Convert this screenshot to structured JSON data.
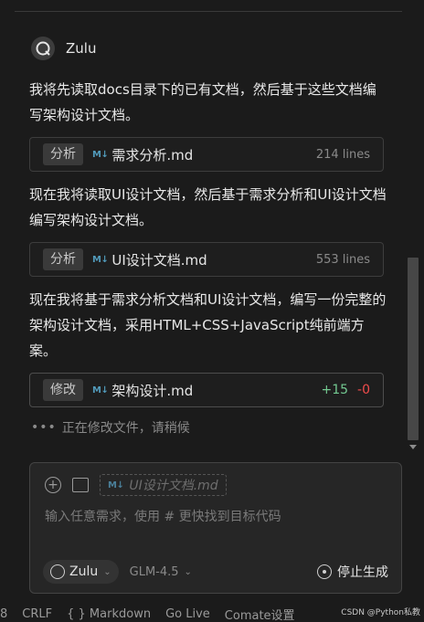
{
  "agent": {
    "name": "Zulu"
  },
  "messages": [
    {
      "text": "我将先读取docs目录下的已有文档，然后基于这些文档编写架构设计文档。"
    },
    {
      "text": "现在我将读取UI设计文档，然后基于需求分析和UI设计文档编写架构设计文档。"
    },
    {
      "text": "现在我将基于需求分析文档和UI设计文档，编写一份完整的架构设计文档，采用HTML+CSS+JavaScript纯前端方案。"
    }
  ],
  "file_cards": [
    {
      "tag": "分析",
      "icon": "markdown-icon",
      "icon_text": "M↓",
      "name": "需求分析.md",
      "meta": "214 lines"
    },
    {
      "tag": "分析",
      "icon": "markdown-icon",
      "icon_text": "M↓",
      "name": "UI设计文档.md",
      "meta": "553 lines"
    },
    {
      "tag": "修改",
      "icon": "markdown-icon",
      "icon_text": "M↓",
      "name": "架构设计.md",
      "added": "+15",
      "removed": "-0"
    }
  ],
  "status": {
    "dots": "•••",
    "text": "正在修改文件，请稍候"
  },
  "composer": {
    "context_icon_text": "M↓",
    "context_file": "UI设计文档.md",
    "placeholder": "输入任意需求，使用 # 更快找到目标代码",
    "add_glyph": "+",
    "agent_label": "Zulu",
    "model_label": "GLM-4.5",
    "stop_label": "停止生成"
  },
  "statusbar": {
    "items": [
      "8",
      "CRLF",
      "{ } Markdown",
      "Go Live",
      "Comate设置"
    ],
    "watermark": "CSDN @Python私教"
  },
  "colors": {
    "accent_md": "#519aba",
    "diff_add": "#73c991",
    "diff_del": "#f14c4c"
  }
}
